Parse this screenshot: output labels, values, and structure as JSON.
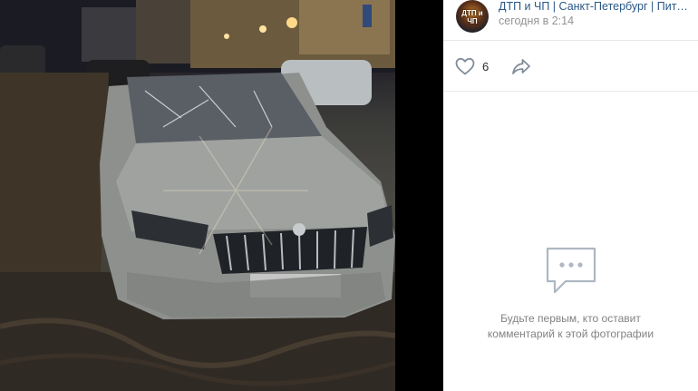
{
  "post": {
    "avatar_text_line1": "ДТП и ЧП",
    "group_name": "ДТП и ЧП | Санкт-Петербург | Питер Онлайн | СПб",
    "time": "сегодня в 2:14"
  },
  "actions": {
    "like_count": "6"
  },
  "comments": {
    "empty_text": "Будьте первым, кто оставит комментарий к этой фотографии"
  },
  "photo": {
    "subject": "car-with-broken-windshield"
  },
  "colors": {
    "link": "#2a5885",
    "muted": "#939393",
    "icon": "#818c99",
    "empty_icon": "#aeb7c2"
  }
}
